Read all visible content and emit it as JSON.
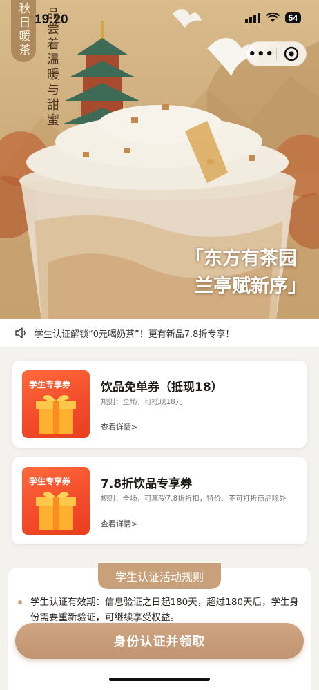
{
  "status_bar": {
    "time": "19:20",
    "battery": "54"
  },
  "hero": {
    "side_tag": "秋日暖茶",
    "vertical_text": "品尝着温暖与甜蜜",
    "slogan_line1": "「东方有茶园",
    "slogan_line2": "兰亭赋新序」"
  },
  "capsule": {
    "more_label": "•••"
  },
  "notice": {
    "text": "学生认证解锁“0元喝奶茶”！更有新品7.8折专享！"
  },
  "coupons": [
    {
      "badge": "学生专享券",
      "title": "饮品免单券（抵现18）",
      "rule": "规则：全场，可抵现18元",
      "link": "查看详情>"
    },
    {
      "badge": "学生专享券",
      "title": "7.8折饮品专享券",
      "rule": "规则：全场，可享受7.8折折扣，特价、不可打折商品除外",
      "link": "查看详情>"
    }
  ],
  "rules": {
    "tab": "学生认证活动规则",
    "item1": "学生认证有效期：信息验证之日起180天，超过180天后，学生身份需要重新验证，可继续享受权益。"
  },
  "cta": {
    "label": "身份认证并领取"
  },
  "colors": {
    "accent": "#c8a07a",
    "coupon_red": "#f24a2a"
  }
}
